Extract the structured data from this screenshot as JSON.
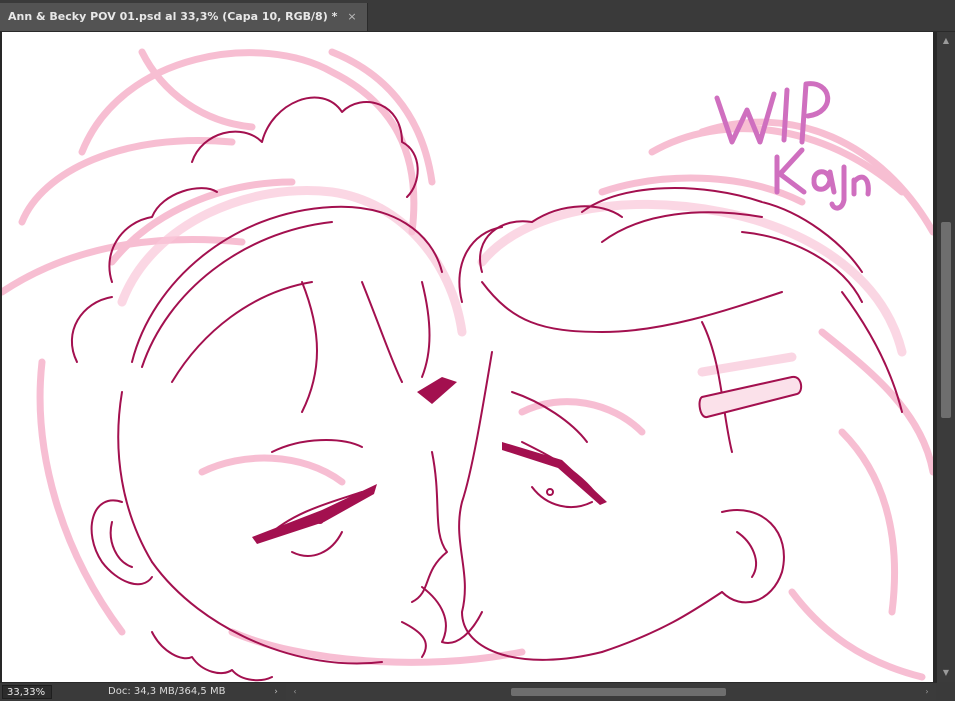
{
  "document_tab": {
    "title": "Ann & Becky POV 01.psd al 33,3% (Capa 10, RGB/8) *",
    "close_glyph": "×"
  },
  "canvas": {
    "watermark_line1": "WIP",
    "watermark_line2": "Kajín",
    "sketch_color": "#f4b0c8",
    "ink_color": "#a3104f",
    "watermark_color": "#cf6fbf"
  },
  "status": {
    "zoom": "33,33%",
    "doc_info": "Doc: 34,3 MB/364,5 MB",
    "menu_arrow": "›"
  },
  "scrollbars": {
    "up": "▲",
    "down": "▼",
    "left": "‹",
    "right": "›"
  }
}
